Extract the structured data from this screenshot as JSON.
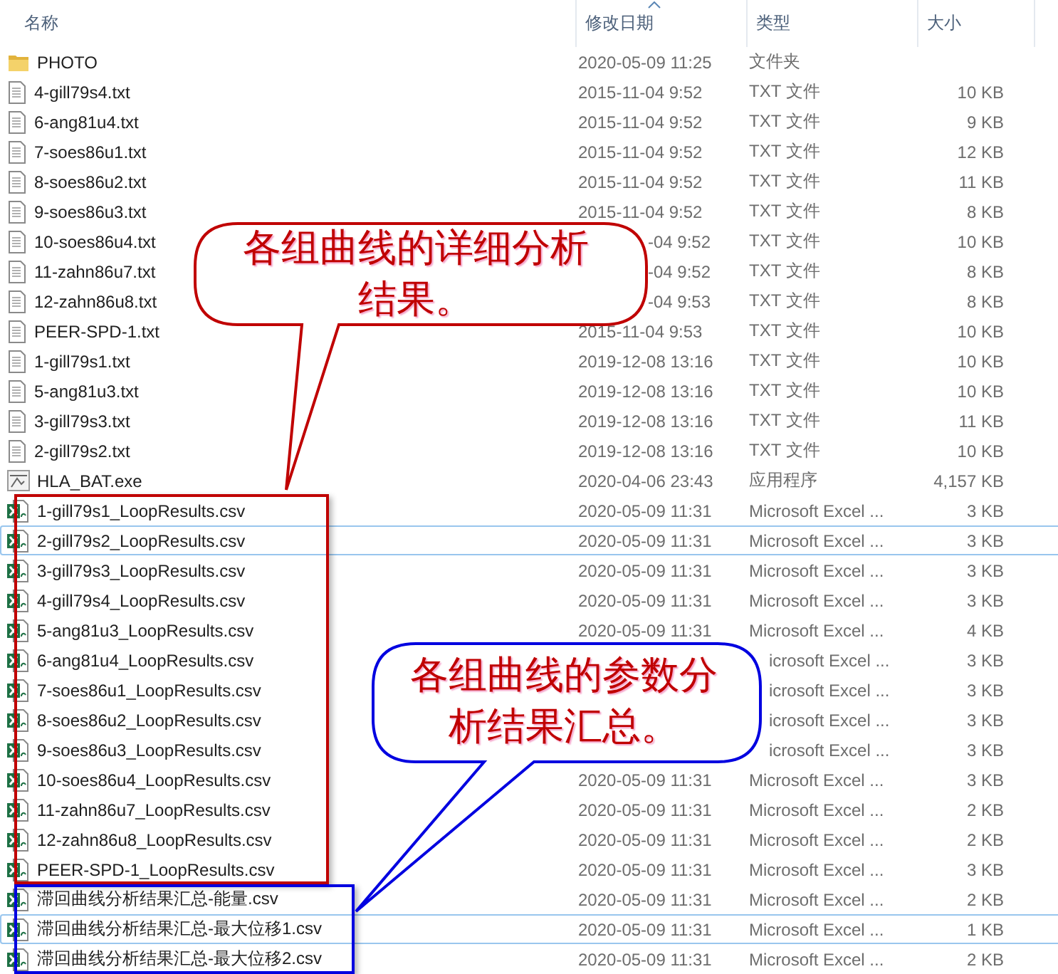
{
  "columns": [
    {
      "label": "名称",
      "sorted": false
    },
    {
      "label": "修改日期",
      "sorted": true
    },
    {
      "label": "类型",
      "sorted": false
    },
    {
      "label": "大小",
      "sorted": false
    }
  ],
  "rows": [
    {
      "kind": "folder",
      "name": "PHOTO",
      "date": "2020-05-09 11:25",
      "date_cut": false,
      "type": "文件夹",
      "type_cut": false,
      "size": "",
      "focused": false
    },
    {
      "kind": "text",
      "name": "4-gill79s4.txt",
      "date": "2015-11-04 9:52",
      "date_cut": false,
      "type": "TXT 文件",
      "type_cut": false,
      "size": "10 KB",
      "focused": false
    },
    {
      "kind": "text",
      "name": "6-ang81u4.txt",
      "date": "2015-11-04 9:52",
      "date_cut": false,
      "type": "TXT 文件",
      "type_cut": false,
      "size": "9 KB",
      "focused": false
    },
    {
      "kind": "text",
      "name": "7-soes86u1.txt",
      "date": "2015-11-04 9:52",
      "date_cut": false,
      "type": "TXT 文件",
      "type_cut": false,
      "size": "12 KB",
      "focused": false
    },
    {
      "kind": "text",
      "name": "8-soes86u2.txt",
      "date": "2015-11-04 9:52",
      "date_cut": false,
      "type": "TXT 文件",
      "type_cut": false,
      "size": "11 KB",
      "focused": false
    },
    {
      "kind": "text",
      "name": "9-soes86u3.txt",
      "date": "2015-11-04 9:52",
      "date_cut": false,
      "type": "TXT 文件",
      "type_cut": false,
      "size": "8 KB",
      "focused": false
    },
    {
      "kind": "text",
      "name": "10-soes86u4.txt",
      "date": "-04 9:52",
      "date_cut": true,
      "type": "TXT 文件",
      "type_cut": false,
      "size": "10 KB",
      "focused": false
    },
    {
      "kind": "text",
      "name": "11-zahn86u7.txt",
      "date": "-04 9:52",
      "date_cut": true,
      "type": "TXT 文件",
      "type_cut": false,
      "size": "8 KB",
      "focused": false
    },
    {
      "kind": "text",
      "name": "12-zahn86u8.txt",
      "date": "-04 9:53",
      "date_cut": true,
      "type": "TXT 文件",
      "type_cut": false,
      "size": "8 KB",
      "focused": false
    },
    {
      "kind": "text",
      "name": "PEER-SPD-1.txt",
      "date": "2015-11-04 9:53",
      "date_cut": false,
      "type": "TXT 文件",
      "type_cut": false,
      "size": "10 KB",
      "focused": false
    },
    {
      "kind": "text",
      "name": "1-gill79s1.txt",
      "date": "2019-12-08 13:16",
      "date_cut": false,
      "type": "TXT 文件",
      "type_cut": false,
      "size": "10 KB",
      "focused": false
    },
    {
      "kind": "text",
      "name": "5-ang81u3.txt",
      "date": "2019-12-08 13:16",
      "date_cut": false,
      "type": "TXT 文件",
      "type_cut": false,
      "size": "10 KB",
      "focused": false
    },
    {
      "kind": "text",
      "name": "3-gill79s3.txt",
      "date": "2019-12-08 13:16",
      "date_cut": false,
      "type": "TXT 文件",
      "type_cut": false,
      "size": "11 KB",
      "focused": false
    },
    {
      "kind": "text",
      "name": "2-gill79s2.txt",
      "date": "2019-12-08 13:16",
      "date_cut": false,
      "type": "TXT 文件",
      "type_cut": false,
      "size": "10 KB",
      "focused": false
    },
    {
      "kind": "exe",
      "name": "HLA_BAT.exe",
      "date": "2020-04-06 23:43",
      "date_cut": false,
      "type": "应用程序",
      "type_cut": false,
      "size": "4,157 KB",
      "focused": false
    },
    {
      "kind": "excel",
      "name": "1-gill79s1_LoopResults.csv",
      "date": "2020-05-09 11:31",
      "date_cut": false,
      "type": "Microsoft Excel ...",
      "type_cut": false,
      "size": "3 KB",
      "focused": false
    },
    {
      "kind": "excel",
      "name": "2-gill79s2_LoopResults.csv",
      "date": "2020-05-09 11:31",
      "date_cut": false,
      "type": "Microsoft Excel ...",
      "type_cut": false,
      "size": "3 KB",
      "focused": true
    },
    {
      "kind": "excel",
      "name": "3-gill79s3_LoopResults.csv",
      "date": "2020-05-09 11:31",
      "date_cut": false,
      "type": "Microsoft Excel ...",
      "type_cut": false,
      "size": "3 KB",
      "focused": false
    },
    {
      "kind": "excel",
      "name": "4-gill79s4_LoopResults.csv",
      "date": "2020-05-09 11:31",
      "date_cut": false,
      "type": "Microsoft Excel ...",
      "type_cut": false,
      "size": "3 KB",
      "focused": false
    },
    {
      "kind": "excel",
      "name": "5-ang81u3_LoopResults.csv",
      "date": "2020-05-09 11:31",
      "date_cut": false,
      "type": "Microsoft Excel ...",
      "type_cut": false,
      "size": "4 KB",
      "focused": false
    },
    {
      "kind": "excel",
      "name": "6-ang81u4_LoopResults.csv",
      "type": "icrosoft Excel ...",
      "type_cut": true,
      "size": "3 KB",
      "focused": false
    },
    {
      "kind": "excel",
      "name": "7-soes86u1_LoopResults.csv",
      "type": "icrosoft Excel ...",
      "type_cut": true,
      "size": "3 KB",
      "focused": false
    },
    {
      "kind": "excel",
      "name": "8-soes86u2_LoopResults.csv",
      "type": "icrosoft Excel ...",
      "type_cut": true,
      "size": "3 KB",
      "focused": false
    },
    {
      "kind": "excel",
      "name": "9-soes86u3_LoopResults.csv",
      "type": "icrosoft Excel ...",
      "type_cut": true,
      "size": "3 KB",
      "focused": false
    },
    {
      "kind": "excel",
      "name": "10-soes86u4_LoopResults.csv",
      "date": "2020-05-09 11:31",
      "date_cut": false,
      "type": "Microsoft Excel ...",
      "type_cut": false,
      "size": "3 KB",
      "focused": false
    },
    {
      "kind": "excel",
      "name": "11-zahn86u7_LoopResults.csv",
      "date": "2020-05-09 11:31",
      "date_cut": false,
      "type": "Microsoft Excel ...",
      "type_cut": false,
      "size": "2 KB",
      "focused": false
    },
    {
      "kind": "excel",
      "name": "12-zahn86u8_LoopResults.csv",
      "date": "2020-05-09 11:31",
      "date_cut": false,
      "type": "Microsoft Excel ...",
      "type_cut": false,
      "size": "2 KB",
      "focused": false
    },
    {
      "kind": "excel",
      "name": "PEER-SPD-1_LoopResults.csv",
      "date": "2020-05-09 11:31",
      "date_cut": false,
      "type": "Microsoft Excel ...",
      "type_cut": false,
      "size": "3 KB",
      "focused": false
    },
    {
      "kind": "excel",
      "name": "滞回曲线分析结果汇总-能量.csv",
      "date": "2020-05-09 11:31",
      "date_cut": false,
      "type": "Microsoft Excel ...",
      "type_cut": false,
      "size": "2 KB",
      "focused": false
    },
    {
      "kind": "excel",
      "name": "滞回曲线分析结果汇总-最大位移1.csv",
      "date": "2020-05-09 11:31",
      "date_cut": false,
      "type": "Microsoft Excel ...",
      "type_cut": false,
      "size": "1 KB",
      "focused": true
    },
    {
      "kind": "excel",
      "name": "滞回曲线分析结果汇总-最大位移2.csv",
      "date": "2020-05-09 11:31",
      "date_cut": false,
      "type": "Microsoft Excel ...",
      "type_cut": false,
      "size": "2 KB",
      "focused": false
    }
  ],
  "callouts": [
    {
      "text": "各组曲线的详细分析结果。",
      "color": "#c00000"
    },
    {
      "text": "各组曲线的参数分析结果汇总。",
      "color": "#0000e0"
    }
  ]
}
